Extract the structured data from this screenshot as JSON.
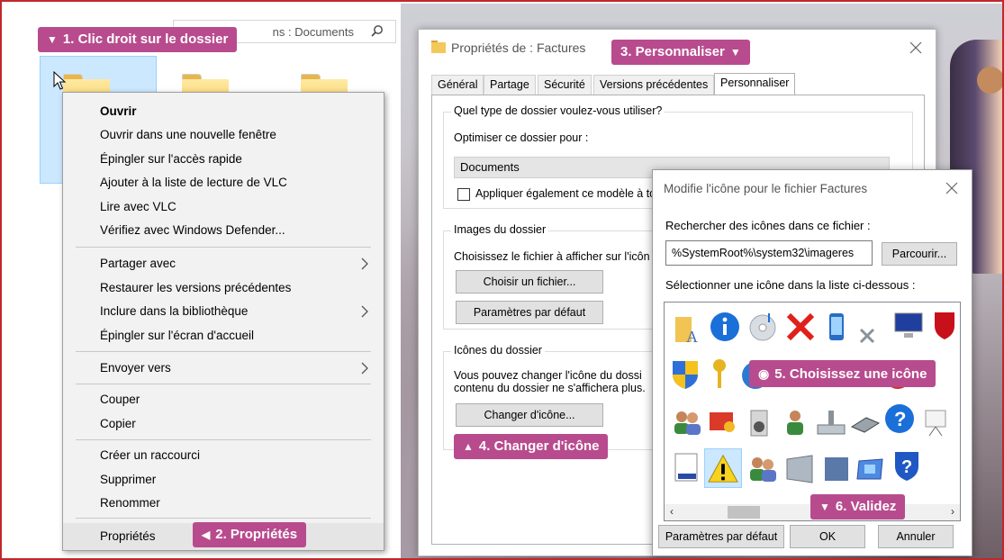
{
  "explorer": {
    "search_text": "ns : Documents"
  },
  "context_menu": {
    "items": [
      {
        "label": "Ouvrir"
      },
      {
        "label": "Ouvrir dans une nouvelle fenêtre"
      },
      {
        "label": "Épingler sur l'accès rapide"
      },
      {
        "label": "Ajouter à la liste de lecture de VLC"
      },
      {
        "label": "Lire avec VLC"
      },
      {
        "label": "Vérifiez avec Windows Defender..."
      },
      {
        "label": "Partager avec"
      },
      {
        "label": "Restaurer les versions précédentes"
      },
      {
        "label": "Inclure dans la bibliothèque"
      },
      {
        "label": "Épingler sur l'écran d'accueil"
      },
      {
        "label": "Envoyer vers"
      },
      {
        "label": "Couper"
      },
      {
        "label": "Copier"
      },
      {
        "label": "Créer un raccourci"
      },
      {
        "label": "Supprimer"
      },
      {
        "label": "Renommer"
      },
      {
        "label": "Propriétés"
      }
    ]
  },
  "steps": {
    "s1": "1. Clic droit sur le dossier",
    "s2": "2. Propriétés",
    "s3": "3. Personnaliser",
    "s4": "4. Changer d'icône",
    "s5": "5. Choisissez une icône",
    "s6": "6. Validez"
  },
  "properties": {
    "title": "Propriétés de : Factures",
    "tabs": [
      {
        "label": "Général"
      },
      {
        "label": "Partage"
      },
      {
        "label": "Sécurité"
      },
      {
        "label": "Versions précédentes"
      },
      {
        "label": "Personnaliser"
      }
    ],
    "folder_type_group": "Quel type de dossier voulez-vous utiliser?",
    "optimize_label": "Optimiser ce dossier pour :",
    "optimize_value": "Documents",
    "apply_template": "Appliquer également ce modèle à to",
    "images_group": "Images du dossier",
    "images_desc": "Choisissez le fichier à afficher sur l'icôn",
    "choose_file": "Choisir un fichier...",
    "default_params": "Paramètres par défaut",
    "icons_group": "Icônes du dossier",
    "icons_desc_1": "Vous pouvez changer l'icône du dossi",
    "icons_desc_2": "contenu du dossier ne s'affichera plus.",
    "change_icon": "Changer d'icône..."
  },
  "icon_dialog": {
    "title": "Modifie l'icône pour le fichier Factures",
    "search_label": "Rechercher des icônes dans ce fichier :",
    "path_value": "%SystemRoot%\\system32\\imageres",
    "browse": "Parcourir...",
    "select_label": "Sélectionner une icône dans la liste ci-dessous :",
    "default_btn": "Paramètres par défaut",
    "ok_btn": "OK",
    "cancel_btn": "Annuler"
  }
}
